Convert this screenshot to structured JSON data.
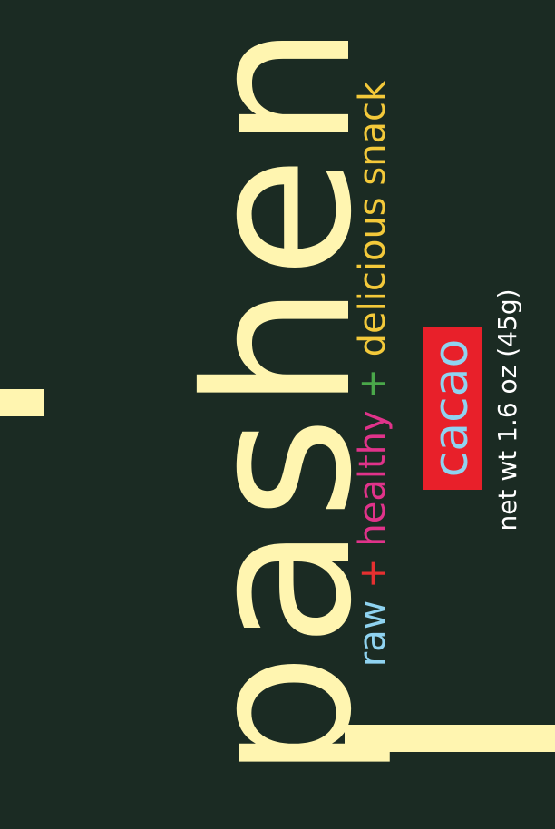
{
  "colors": {
    "background": "#1b2b23",
    "cream": "#fff5b0",
    "badge_red": "#e8202a",
    "raw": "#8fd3f0",
    "plus_red": "#e63030",
    "healthy": "#e0338a",
    "plus_green": "#4aa84a",
    "delicious": "#f3c93a"
  },
  "brand": {
    "name": "pashen"
  },
  "tagline": {
    "raw": "raw",
    "plus1": "+",
    "healthy": "healthy",
    "plus2": "+",
    "delicious": "delicious snack"
  },
  "flavor": {
    "label": "cacao"
  },
  "net_weight": {
    "text": "net wt 1.6 oz (45g)"
  }
}
